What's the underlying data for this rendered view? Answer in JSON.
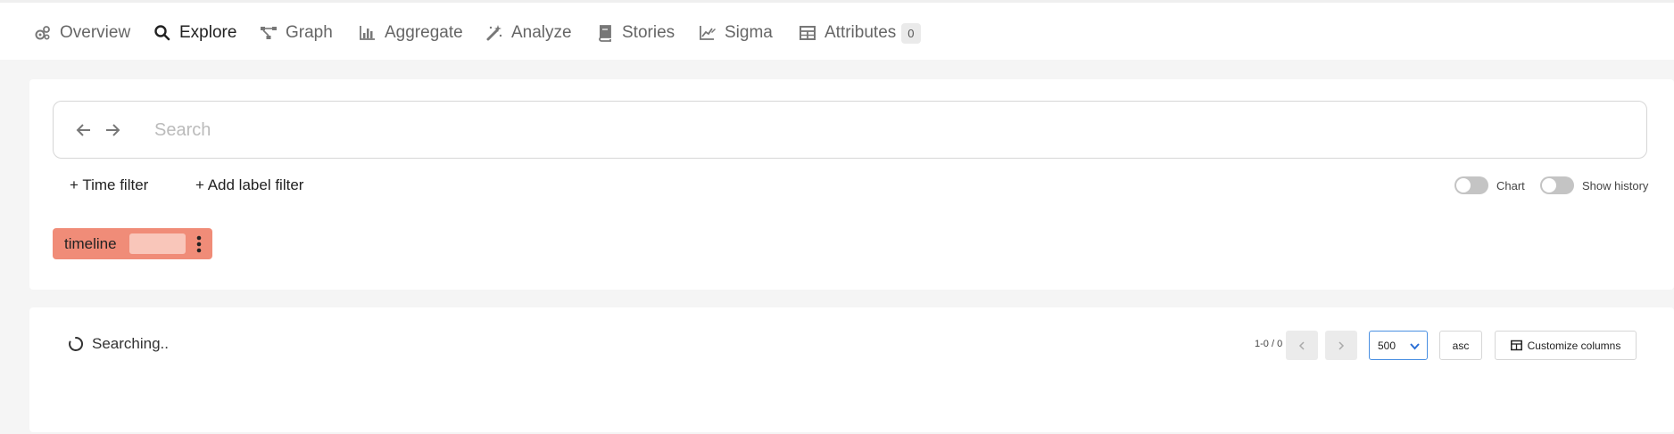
{
  "nav": {
    "items": [
      {
        "label": "Overview",
        "icon": "cogs-icon"
      },
      {
        "label": "Explore",
        "icon": "search-icon",
        "active": true
      },
      {
        "label": "Graph",
        "icon": "graph-icon"
      },
      {
        "label": "Aggregate",
        "icon": "bar-chart-icon"
      },
      {
        "label": "Analyze",
        "icon": "magic-wand-icon"
      },
      {
        "label": "Stories",
        "icon": "book-icon"
      },
      {
        "label": "Sigma",
        "icon": "chart-edit-icon"
      },
      {
        "label": "Attributes",
        "icon": "table-icon",
        "badge": "0"
      }
    ]
  },
  "search": {
    "placeholder": "Search",
    "value": ""
  },
  "filters": {
    "time_filter": "+ Time filter",
    "label_filter": "+ Add label filter"
  },
  "toggles": {
    "chart": {
      "label": "Chart",
      "on": false
    },
    "history": {
      "label": "Show history",
      "on": false
    }
  },
  "timeline_chip": {
    "label": "timeline",
    "color": "#f08c78",
    "swatch_color": "#f9c6ba"
  },
  "results": {
    "status": "Searching..",
    "range": "1-0 / 0",
    "page_size": "500",
    "sort": "asc",
    "customize": "Customize columns"
  },
  "colors": {
    "accent": "#4a90e2",
    "chip": "#f08c78"
  }
}
